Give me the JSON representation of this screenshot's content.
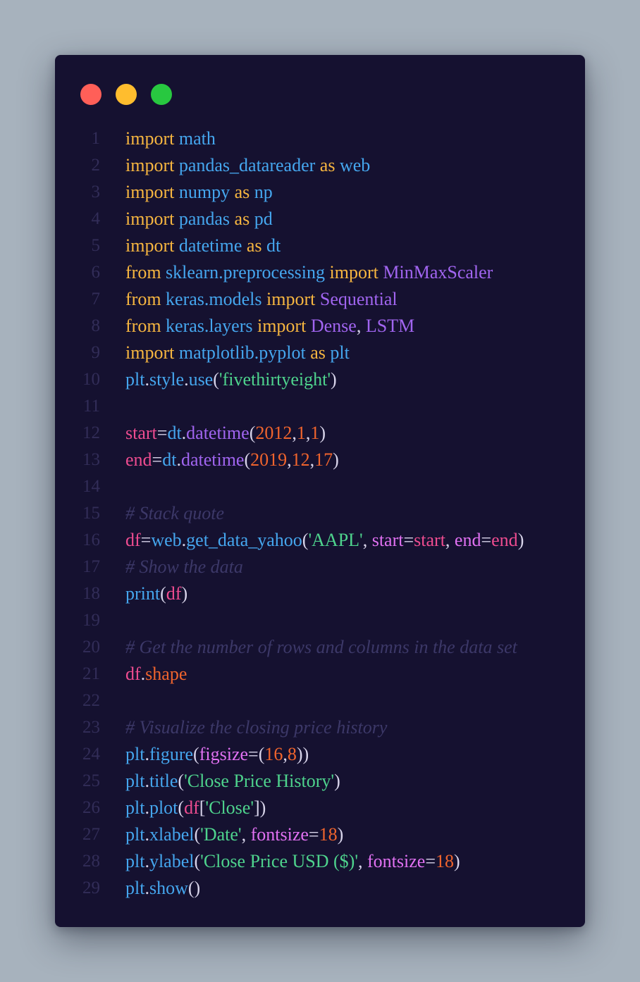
{
  "window": {
    "controls": [
      "close",
      "minimize",
      "zoom"
    ]
  },
  "code": {
    "lines": [
      {
        "n": "1",
        "tokens": [
          [
            "kw",
            "import"
          ],
          [
            "op",
            " "
          ],
          [
            "mod",
            "math"
          ]
        ]
      },
      {
        "n": "2",
        "tokens": [
          [
            "kw",
            "import"
          ],
          [
            "op",
            " "
          ],
          [
            "mod",
            "pandas_datareader"
          ],
          [
            "op",
            " "
          ],
          [
            "kw",
            "as"
          ],
          [
            "op",
            " "
          ],
          [
            "mod",
            "web"
          ]
        ]
      },
      {
        "n": "3",
        "tokens": [
          [
            "kw",
            "import"
          ],
          [
            "op",
            " "
          ],
          [
            "mod",
            "numpy"
          ],
          [
            "op",
            " "
          ],
          [
            "kw",
            "as"
          ],
          [
            "op",
            " "
          ],
          [
            "mod",
            "np"
          ]
        ]
      },
      {
        "n": "4",
        "tokens": [
          [
            "kw",
            "import"
          ],
          [
            "op",
            " "
          ],
          [
            "mod",
            "pandas"
          ],
          [
            "op",
            " "
          ],
          [
            "kw",
            "as"
          ],
          [
            "op",
            " "
          ],
          [
            "mod",
            "pd"
          ]
        ]
      },
      {
        "n": "5",
        "tokens": [
          [
            "kw",
            "import"
          ],
          [
            "op",
            " "
          ],
          [
            "mod",
            "datetime"
          ],
          [
            "op",
            " "
          ],
          [
            "kw",
            "as"
          ],
          [
            "op",
            " "
          ],
          [
            "mod",
            "dt"
          ]
        ]
      },
      {
        "n": "6",
        "tokens": [
          [
            "kw",
            "from"
          ],
          [
            "op",
            " "
          ],
          [
            "mod",
            "sklearn.preprocessing"
          ],
          [
            "op",
            " "
          ],
          [
            "kw",
            "import"
          ],
          [
            "op",
            " "
          ],
          [
            "cls",
            "MinMaxScaler"
          ]
        ]
      },
      {
        "n": "7",
        "tokens": [
          [
            "kw",
            "from"
          ],
          [
            "op",
            " "
          ],
          [
            "mod",
            "keras.models"
          ],
          [
            "op",
            " "
          ],
          [
            "kw",
            "import"
          ],
          [
            "op",
            " "
          ],
          [
            "cls",
            "Sequential"
          ]
        ]
      },
      {
        "n": "8",
        "tokens": [
          [
            "kw",
            "from"
          ],
          [
            "op",
            " "
          ],
          [
            "mod",
            "keras.layers"
          ],
          [
            "op",
            " "
          ],
          [
            "kw",
            "import"
          ],
          [
            "op",
            " "
          ],
          [
            "cls",
            "Dense"
          ],
          [
            "op",
            ", "
          ],
          [
            "cls",
            "LSTM"
          ]
        ]
      },
      {
        "n": "9",
        "tokens": [
          [
            "kw",
            "import"
          ],
          [
            "op",
            " "
          ],
          [
            "mod",
            "matplotlib.pyplot"
          ],
          [
            "op",
            " "
          ],
          [
            "kw",
            "as"
          ],
          [
            "op",
            " "
          ],
          [
            "mod",
            "plt"
          ]
        ]
      },
      {
        "n": "10",
        "tokens": [
          [
            "mod",
            "plt"
          ],
          [
            "op",
            "."
          ],
          [
            "mod",
            "style"
          ],
          [
            "op",
            "."
          ],
          [
            "mod",
            "use"
          ],
          [
            "op",
            "("
          ],
          [
            "str",
            "'fivethirtyeight'"
          ],
          [
            "op",
            ")"
          ]
        ]
      },
      {
        "n": "11",
        "tokens": []
      },
      {
        "n": "12",
        "tokens": [
          [
            "var",
            "start"
          ],
          [
            "op",
            "="
          ],
          [
            "mod",
            "dt"
          ],
          [
            "op",
            "."
          ],
          [
            "cls",
            "datetime"
          ],
          [
            "op",
            "("
          ],
          [
            "num",
            "2012"
          ],
          [
            "op",
            ","
          ],
          [
            "num",
            "1"
          ],
          [
            "op",
            ","
          ],
          [
            "num",
            "1"
          ],
          [
            "op",
            ")"
          ]
        ]
      },
      {
        "n": "13",
        "tokens": [
          [
            "var",
            "end"
          ],
          [
            "op",
            "="
          ],
          [
            "mod",
            "dt"
          ],
          [
            "op",
            "."
          ],
          [
            "cls",
            "datetime"
          ],
          [
            "op",
            "("
          ],
          [
            "num",
            "2019"
          ],
          [
            "op",
            ","
          ],
          [
            "num",
            "12"
          ],
          [
            "op",
            ","
          ],
          [
            "num",
            "17"
          ],
          [
            "op",
            ")"
          ]
        ]
      },
      {
        "n": "14",
        "tokens": []
      },
      {
        "n": "15",
        "tokens": [
          [
            "cmt",
            "# Stack quote"
          ]
        ]
      },
      {
        "n": "16",
        "tokens": [
          [
            "var",
            "df"
          ],
          [
            "op",
            "="
          ],
          [
            "mod",
            "web"
          ],
          [
            "op",
            "."
          ],
          [
            "mod",
            "get_data_yahoo"
          ],
          [
            "op",
            "("
          ],
          [
            "str",
            "'AAPL'"
          ],
          [
            "op",
            ", "
          ],
          [
            "prm",
            "start"
          ],
          [
            "op",
            "="
          ],
          [
            "var",
            "start"
          ],
          [
            "op",
            ", "
          ],
          [
            "prm",
            "end"
          ],
          [
            "op",
            "="
          ],
          [
            "var",
            "end"
          ],
          [
            "op",
            ")"
          ]
        ]
      },
      {
        "n": "17",
        "tokens": [
          [
            "cmt",
            "# Show the data"
          ]
        ]
      },
      {
        "n": "18",
        "tokens": [
          [
            "mod",
            "print"
          ],
          [
            "op",
            "("
          ],
          [
            "var",
            "df"
          ],
          [
            "op",
            ")"
          ]
        ]
      },
      {
        "n": "19",
        "tokens": []
      },
      {
        "n": "20",
        "tokens": [
          [
            "cmt",
            "# Get the number of rows and columns in the data set"
          ]
        ]
      },
      {
        "n": "21",
        "tokens": [
          [
            "var",
            "df"
          ],
          [
            "op",
            "."
          ],
          [
            "num",
            "shape"
          ]
        ]
      },
      {
        "n": "22",
        "tokens": []
      },
      {
        "n": "23",
        "tokens": [
          [
            "cmt",
            "# Visualize the closing price history"
          ]
        ]
      },
      {
        "n": "24",
        "tokens": [
          [
            "mod",
            "plt"
          ],
          [
            "op",
            "."
          ],
          [
            "mod",
            "figure"
          ],
          [
            "op",
            "("
          ],
          [
            "prm",
            "figsize"
          ],
          [
            "op",
            "=("
          ],
          [
            "num",
            "16"
          ],
          [
            "op",
            ","
          ],
          [
            "num",
            "8"
          ],
          [
            "op",
            "))"
          ]
        ]
      },
      {
        "n": "25",
        "tokens": [
          [
            "mod",
            "plt"
          ],
          [
            "op",
            "."
          ],
          [
            "mod",
            "title"
          ],
          [
            "op",
            "("
          ],
          [
            "str",
            "'Close Price History'"
          ],
          [
            "op",
            ")"
          ]
        ]
      },
      {
        "n": "26",
        "tokens": [
          [
            "mod",
            "plt"
          ],
          [
            "op",
            "."
          ],
          [
            "mod",
            "plot"
          ],
          [
            "op",
            "("
          ],
          [
            "var",
            "df"
          ],
          [
            "op",
            "["
          ],
          [
            "str",
            "'Close'"
          ],
          [
            "op",
            "])"
          ]
        ]
      },
      {
        "n": "27",
        "tokens": [
          [
            "mod",
            "plt"
          ],
          [
            "op",
            "."
          ],
          [
            "mod",
            "xlabel"
          ],
          [
            "op",
            "("
          ],
          [
            "str",
            "'Date'"
          ],
          [
            "op",
            ", "
          ],
          [
            "prm",
            "fontsize"
          ],
          [
            "op",
            "="
          ],
          [
            "num",
            "18"
          ],
          [
            "op",
            ")"
          ]
        ]
      },
      {
        "n": "28",
        "tokens": [
          [
            "mod",
            "plt"
          ],
          [
            "op",
            "."
          ],
          [
            "mod",
            "ylabel"
          ],
          [
            "op",
            "("
          ],
          [
            "str",
            "'Close Price USD ($)'"
          ],
          [
            "op",
            ", "
          ],
          [
            "prm",
            "fontsize"
          ],
          [
            "op",
            "="
          ],
          [
            "num",
            "18"
          ],
          [
            "op",
            ")"
          ]
        ]
      },
      {
        "n": "29",
        "tokens": [
          [
            "mod",
            "plt"
          ],
          [
            "op",
            "."
          ],
          [
            "mod",
            "show"
          ],
          [
            "op",
            "()"
          ]
        ]
      }
    ]
  },
  "colors": {
    "background": "#a7b2bd",
    "window": "#151130",
    "keyword": "#f7b640",
    "module": "#45a6ee",
    "class": "#a165f0",
    "variable": "#ee4c90",
    "number": "#f0642d",
    "string": "#4ed38d",
    "param": "#e171f2",
    "comment": "#3c3868",
    "line_number": "#322d58"
  }
}
